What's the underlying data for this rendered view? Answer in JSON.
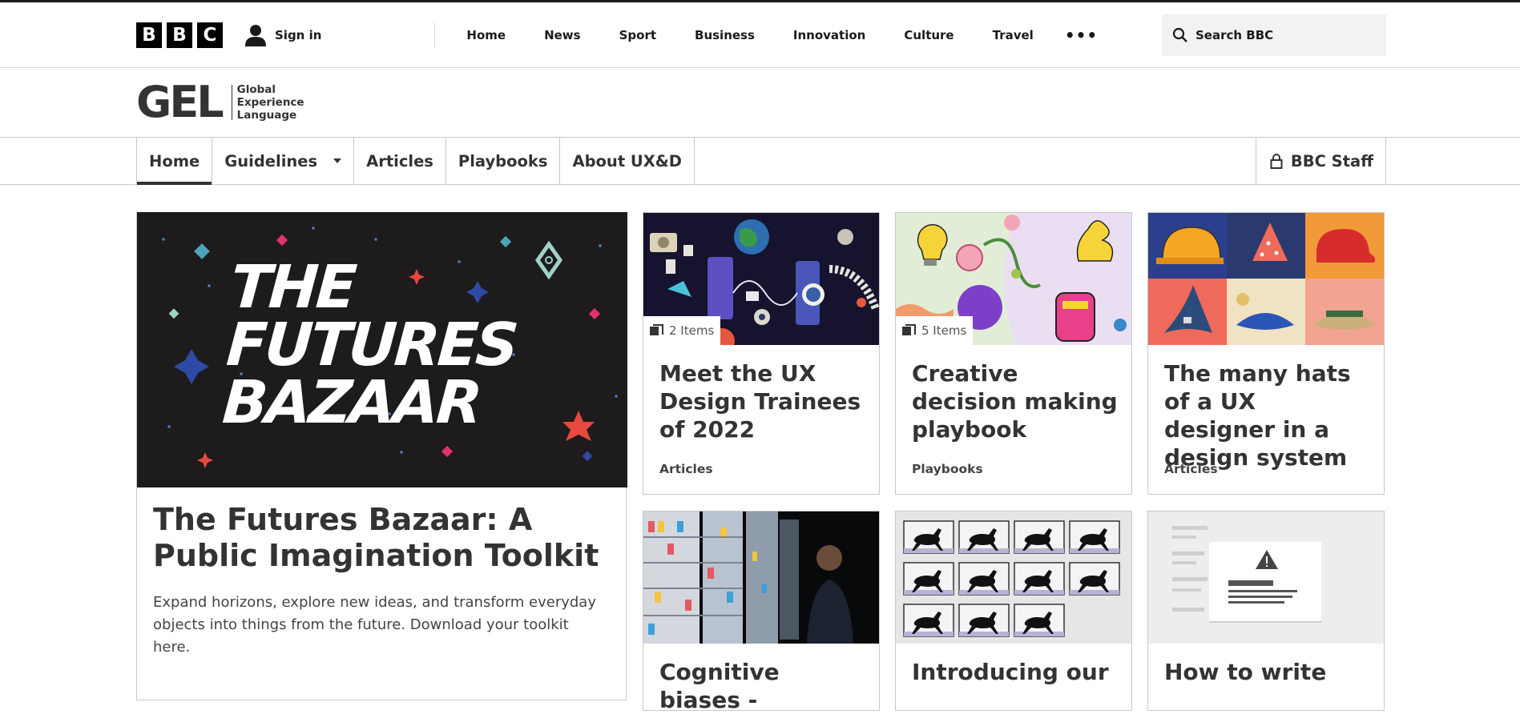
{
  "masthead": {
    "logo_letters": [
      "B",
      "B",
      "C"
    ],
    "sign_in": "Sign in",
    "nav": [
      "Home",
      "News",
      "Sport",
      "Business",
      "Innovation",
      "Culture",
      "Travel"
    ],
    "more": "•••",
    "search_placeholder": "Search BBC"
  },
  "gel": {
    "logo_big": "GEL",
    "logo_line1": "Global",
    "logo_line2": "Experience",
    "logo_line3": "Language"
  },
  "subnav": {
    "items": [
      "Home",
      "Guidelines",
      "Articles",
      "Playbooks",
      "About UX&D"
    ],
    "staff": "BBC Staff"
  },
  "feature": {
    "image_text": [
      "THE",
      "FUTURES",
      "BAZAAR"
    ],
    "title": "The Futures Bazaar: A Public Imagination Toolkit",
    "description": "Expand horizons, explore new ideas, and transform everyday objects into things from the future. Download your toolkit here."
  },
  "cards": [
    {
      "badge": "2 Items",
      "title": "Meet the UX Design Trainees of 2022",
      "category": "Articles"
    },
    {
      "badge": "5 Items",
      "title": "Creative decision making playbook",
      "category": "Playbooks"
    },
    {
      "title": "The many hats of a UX designer in a design system",
      "category": "Articles"
    },
    {
      "title": "Cognitive biases -"
    },
    {
      "title": "Introducing our"
    },
    {
      "title": "How to write"
    }
  ],
  "colors": {
    "text": "#333333",
    "border": "#c8c8c8",
    "feature_bg": "#1d1b1c",
    "search_bg": "#f2f2f2"
  }
}
